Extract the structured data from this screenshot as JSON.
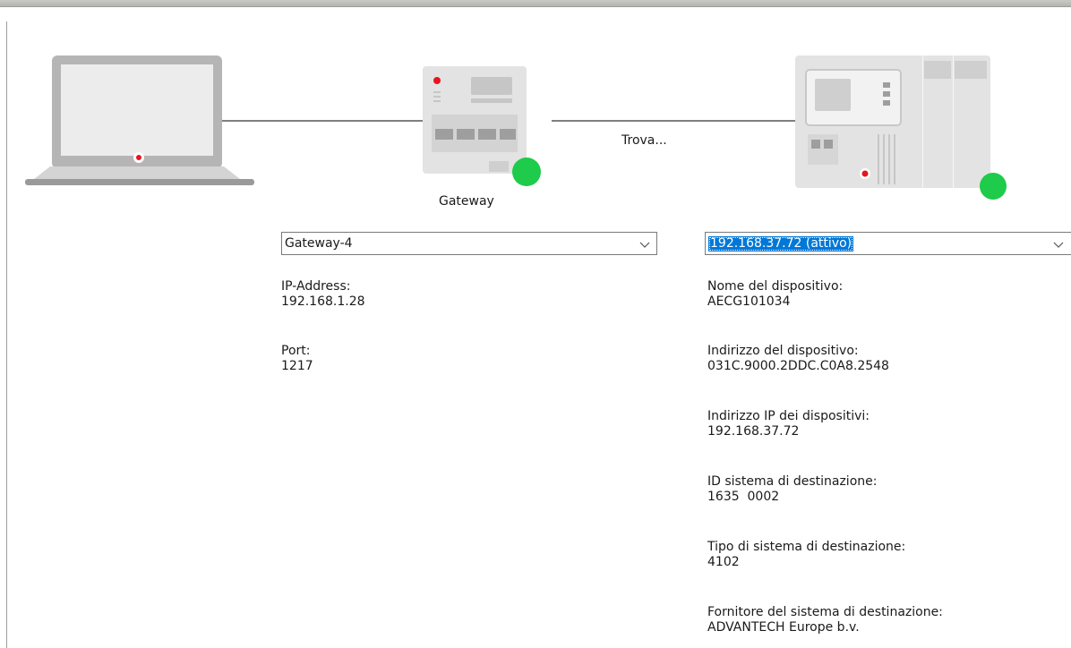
{
  "diagram": {
    "status_text": "Trova...",
    "gateway_label": "Gateway",
    "colors": {
      "wire": "#7f7f7f",
      "device_body": "#e3e3e3",
      "status_online": "#1ecb4a",
      "indicator_red": "#e8141e",
      "selection": "#0078d7"
    }
  },
  "gateway_panel": {
    "select_value": "Gateway-4",
    "fields": [
      {
        "label": "IP-Address:",
        "value": "192.168.1.28"
      },
      {
        "label": "Port:",
        "value": "1217"
      }
    ]
  },
  "device_panel": {
    "select_value": "192.168.37.72 (attivo)",
    "fields": [
      {
        "label": "Nome del dispositivo:",
        "value": "AECG101034"
      },
      {
        "label": "Indirizzo del dispositivo:",
        "value": "031C.9000.2DDC.C0A8.2548"
      },
      {
        "label": "Indirizzo IP dei dispositivi:",
        "value": "192.168.37.72"
      },
      {
        "label": "ID sistema di destinazione:",
        "value": "1635  0002"
      },
      {
        "label": "Tipo di sistema di destinazione:",
        "value": "4102"
      },
      {
        "label": "Fornitore del sistema di destinazione:",
        "value": "ADVANTECH Europe b.v."
      }
    ]
  }
}
